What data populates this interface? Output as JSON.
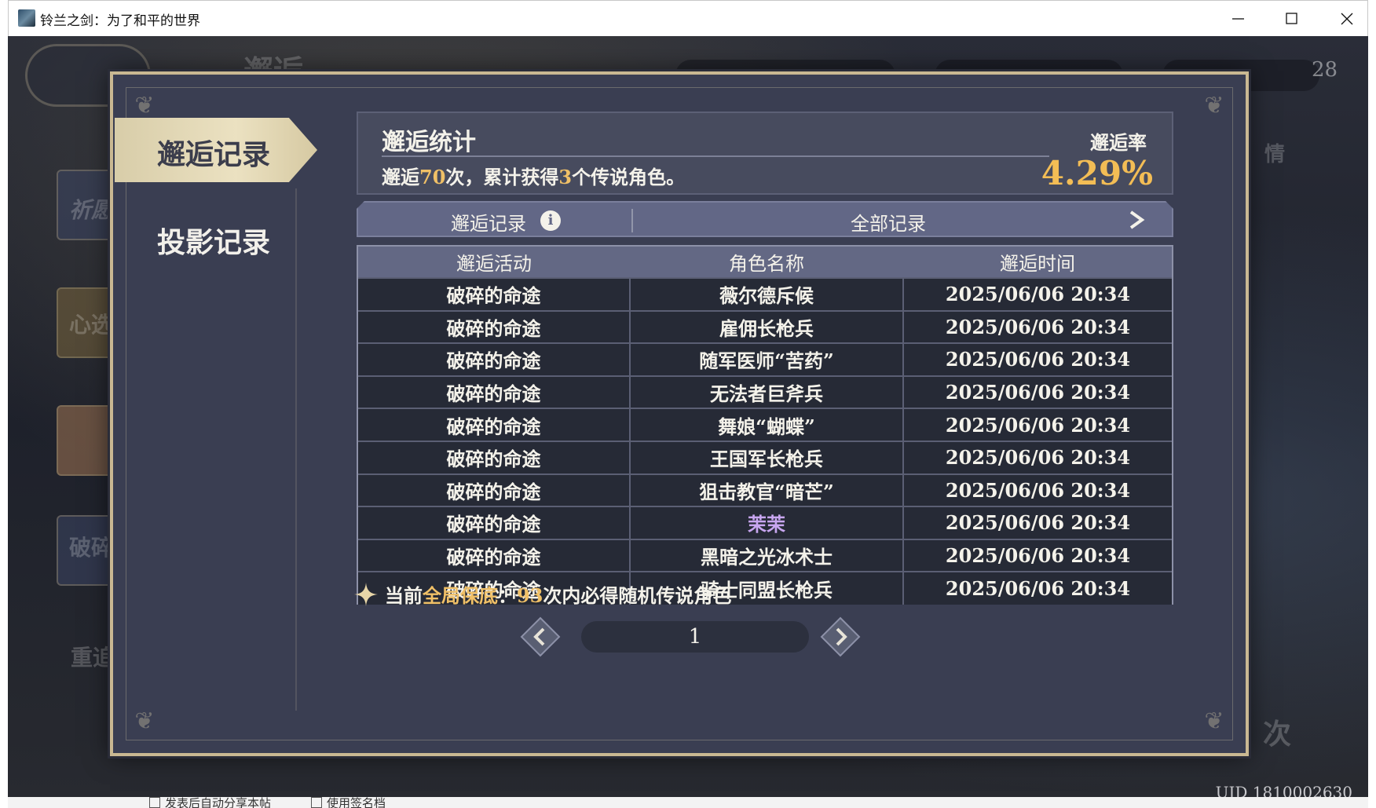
{
  "window": {
    "title": "铃兰之剑：为了和平的世界"
  },
  "background": {
    "uid": "UID 1810002630",
    "ghost_texts": [
      "邂逅",
      "祈愿",
      "心选",
      "破碎",
      "重追",
      "28",
      "情",
      "次"
    ],
    "bottom_options": [
      "发表后自动分享本帖",
      "使用签名档"
    ]
  },
  "tabs": {
    "active": "邂逅记录",
    "inactive": "投影记录"
  },
  "stats": {
    "title": "邂逅统计",
    "desc_prefix": "邂逅",
    "count": "70",
    "desc_mid": "次，累计获得",
    "legend_count": "3",
    "desc_suffix": "个传说角色。",
    "rate_label": "邂逅率",
    "rate_value": "4.29%"
  },
  "filter": {
    "label": "邂逅记录",
    "value": "全部记录"
  },
  "table": {
    "headers": [
      "邂逅活动",
      "角色名称",
      "邂逅时间"
    ],
    "rows": [
      {
        "activity": "破碎的命途",
        "name": "薇尔德斥候",
        "time": "2025/06/06 20:34"
      },
      {
        "activity": "破碎的命途",
        "name": "雇佣长枪兵",
        "time": "2025/06/06 20:34"
      },
      {
        "activity": "破碎的命途",
        "name": "随军医师“苦药”",
        "time": "2025/06/06 20:34"
      },
      {
        "activity": "破碎的命途",
        "name": "无法者巨斧兵",
        "time": "2025/06/06 20:34"
      },
      {
        "activity": "破碎的命途",
        "name": "舞娘“蝴蝶”",
        "time": "2025/06/06 20:34"
      },
      {
        "activity": "破碎的命途",
        "name": "王国军长枪兵",
        "time": "2025/06/06 20:34"
      },
      {
        "activity": "破碎的命途",
        "name": "狙击教官“暗芒”",
        "time": "2025/06/06 20:34"
      },
      {
        "activity": "破碎的命途",
        "name": "茉茉",
        "time": "2025/06/06 20:34",
        "rarity_color": "#c8a6f0"
      },
      {
        "activity": "破碎的命途",
        "name": "黑暗之光冰术士",
        "time": "2025/06/06 20:34"
      },
      {
        "activity": "破碎的命途",
        "name": "骑士同盟长枪兵",
        "time": "2025/06/06 20:34"
      }
    ]
  },
  "pity": {
    "prefix": "当前",
    "highlight": "全局保底",
    "colon": "：",
    "count": "93",
    "suffix": "次内必得随机传说角色"
  },
  "pager": {
    "page": "1"
  },
  "colors": {
    "accent_gold": "#f3bd55",
    "highlight": "#f0c067",
    "rare_purple": "#c8a6f0"
  }
}
